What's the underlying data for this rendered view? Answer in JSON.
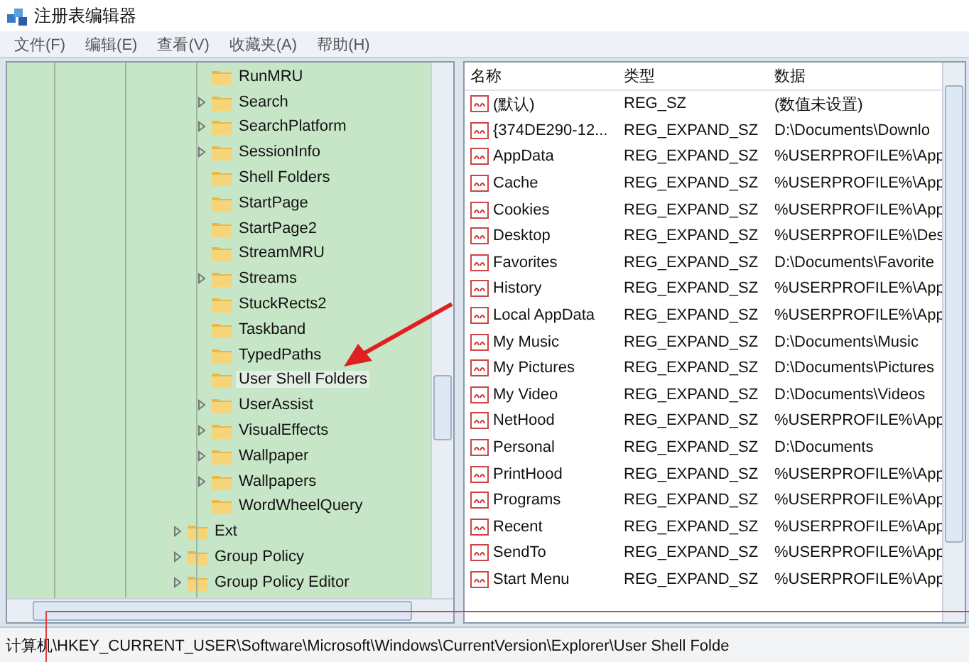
{
  "window": {
    "title": "注册表编辑器"
  },
  "menu": [
    "文件(F)",
    "编辑(E)",
    "查看(V)",
    "收藏夹(A)",
    "帮助(H)"
  ],
  "tree": {
    "items": [
      {
        "children": [
          {
            "label": "RunMRU",
            "expandable": false,
            "selected": false
          },
          {
            "label": "Search",
            "expandable": true,
            "selected": false
          },
          {
            "label": "SearchPlatform",
            "expandable": true,
            "selected": false
          },
          {
            "label": "SessionInfo",
            "expandable": true,
            "selected": false
          },
          {
            "label": "Shell Folders",
            "expandable": false,
            "selected": false
          },
          {
            "label": "StartPage",
            "expandable": false,
            "selected": false
          },
          {
            "label": "StartPage2",
            "expandable": false,
            "selected": false
          },
          {
            "label": "StreamMRU",
            "expandable": false,
            "selected": false
          },
          {
            "label": "Streams",
            "expandable": true,
            "selected": false
          },
          {
            "label": "StuckRects2",
            "expandable": false,
            "selected": false
          },
          {
            "label": "Taskband",
            "expandable": false,
            "selected": false
          },
          {
            "label": "TypedPaths",
            "expandable": false,
            "selected": false
          },
          {
            "label": "User Shell Folders",
            "expandable": false,
            "selected": true
          },
          {
            "label": "UserAssist",
            "expandable": true,
            "selected": false
          },
          {
            "label": "VisualEffects",
            "expandable": true,
            "selected": false
          },
          {
            "label": "Wallpaper",
            "expandable": true,
            "selected": false
          },
          {
            "label": "Wallpapers",
            "expandable": true,
            "selected": false
          },
          {
            "label": "WordWheelQuery",
            "expandable": false,
            "selected": false
          }
        ]
      },
      {
        "label": "Ext",
        "expandable": true,
        "selected": false
      },
      {
        "label": "Group Policy",
        "expandable": true,
        "selected": false
      },
      {
        "label": "Group Policy Editor",
        "expandable": true,
        "selected": false
      }
    ]
  },
  "values": {
    "columns": [
      "名称",
      "类型",
      "数据"
    ],
    "rows": [
      [
        "(默认)",
        "REG_SZ",
        "(数值未设置)"
      ],
      [
        "{374DE290-12...",
        "REG_EXPAND_SZ",
        "D:\\Documents\\Downlo"
      ],
      [
        "AppData",
        "REG_EXPAND_SZ",
        "%USERPROFILE%\\App"
      ],
      [
        "Cache",
        "REG_EXPAND_SZ",
        "%USERPROFILE%\\App"
      ],
      [
        "Cookies",
        "REG_EXPAND_SZ",
        "%USERPROFILE%\\App"
      ],
      [
        "Desktop",
        "REG_EXPAND_SZ",
        "%USERPROFILE%\\Des"
      ],
      [
        "Favorites",
        "REG_EXPAND_SZ",
        "D:\\Documents\\Favorite"
      ],
      [
        "History",
        "REG_EXPAND_SZ",
        "%USERPROFILE%\\App"
      ],
      [
        "Local AppData",
        "REG_EXPAND_SZ",
        "%USERPROFILE%\\App"
      ],
      [
        "My Music",
        "REG_EXPAND_SZ",
        "D:\\Documents\\Music"
      ],
      [
        "My Pictures",
        "REG_EXPAND_SZ",
        "D:\\Documents\\Pictures"
      ],
      [
        "My Video",
        "REG_EXPAND_SZ",
        "D:\\Documents\\Videos"
      ],
      [
        "NetHood",
        "REG_EXPAND_SZ",
        "%USERPROFILE%\\App"
      ],
      [
        "Personal",
        "REG_EXPAND_SZ",
        "D:\\Documents"
      ],
      [
        "PrintHood",
        "REG_EXPAND_SZ",
        "%USERPROFILE%\\App"
      ],
      [
        "Programs",
        "REG_EXPAND_SZ",
        "%USERPROFILE%\\App"
      ],
      [
        "Recent",
        "REG_EXPAND_SZ",
        "%USERPROFILE%\\App"
      ],
      [
        "SendTo",
        "REG_EXPAND_SZ",
        "%USERPROFILE%\\App"
      ],
      [
        "Start Menu",
        "REG_EXPAND_SZ",
        "%USERPROFILE%\\App"
      ]
    ]
  },
  "status_bar": "计算机\\HKEY_CURRENT_USER\\Software\\Microsoft\\Windows\\CurrentVersion\\Explorer\\User Shell Folde"
}
